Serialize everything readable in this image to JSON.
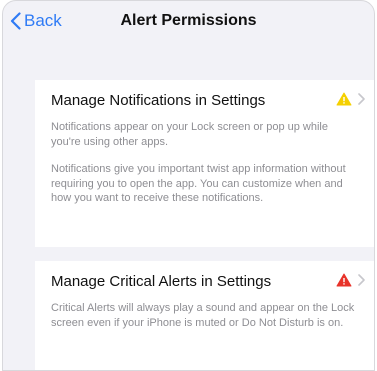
{
  "nav": {
    "back_label": "Back",
    "title": "Alert Permissions"
  },
  "notifications": {
    "title": "Manage Notifications in Settings",
    "icon_color": "#f5d000",
    "desc1": "Notifications appear on your Lock screen or pop up while you're using other apps.",
    "desc2": "Notifications give you important twist app information without requiring you to open the app.  You can customize when and how you want to receive these notifications."
  },
  "critical": {
    "title": "Manage Critical Alerts in Settings",
    "icon_color": "#e8332a",
    "desc": "Critical Alerts will always play a sound and appear on the Lock screen even if your iPhone is muted or Do Not Disturb is on."
  },
  "colors": {
    "accent": "#2f7bf5",
    "background": "#f2f2f7"
  }
}
